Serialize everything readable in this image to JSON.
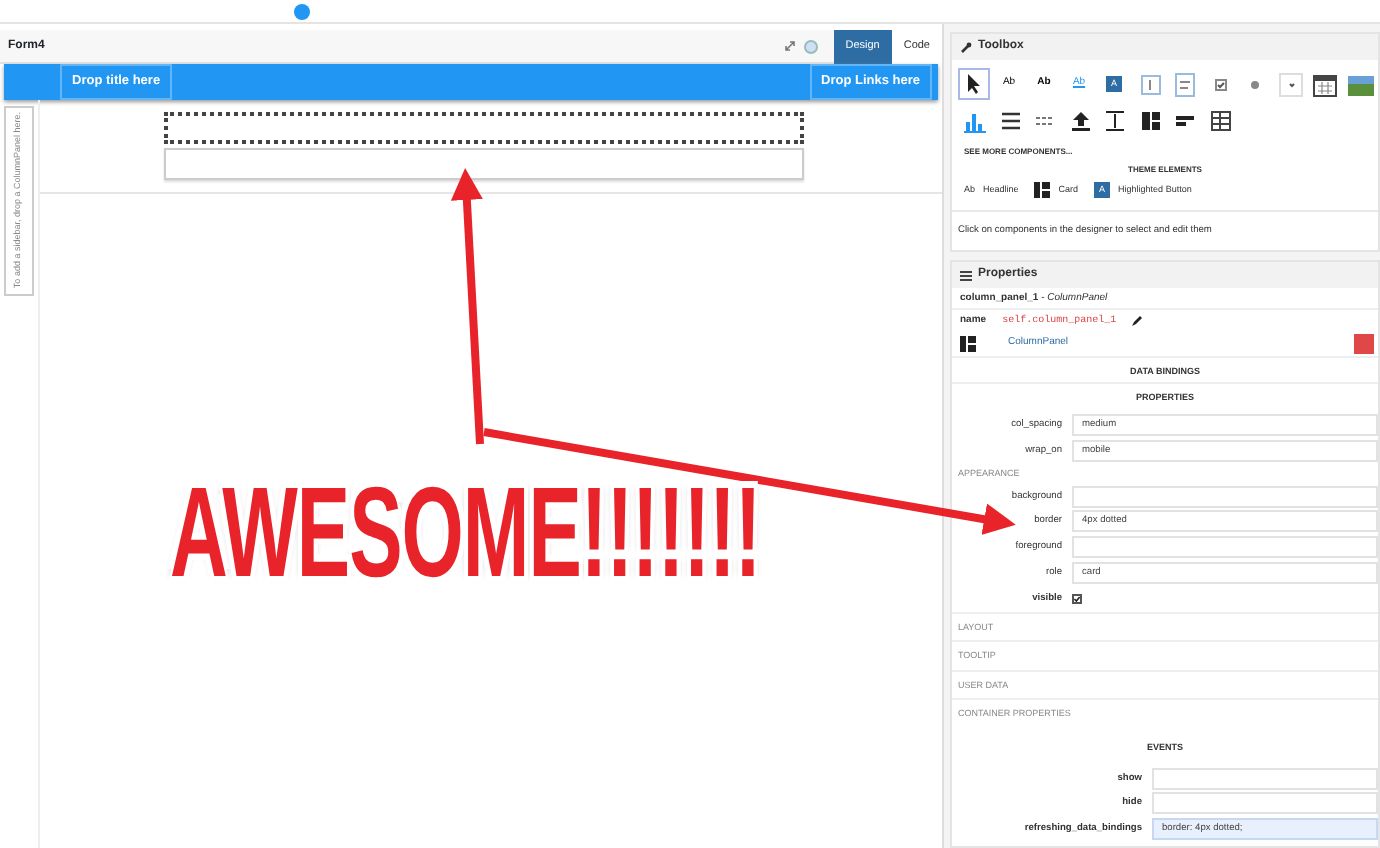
{
  "designer": {
    "title": "Form4",
    "tabs": [
      {
        "label": "Design",
        "selected": true
      },
      {
        "label": "Code",
        "selected": false
      }
    ],
    "navbar": {
      "title_slot": "Drop title here",
      "links_slot": "Drop Links here"
    },
    "sidebar_hint": "To add a sidebar, drop a ColumnPanel here."
  },
  "annotation": {
    "text": "AWESOME!!!!!!!"
  },
  "toolbox": {
    "title": "Toolbox",
    "components": [
      {
        "kind": "pointer",
        "selected": true
      },
      {
        "kind": "label",
        "label": "Ab",
        "selected": false
      },
      {
        "kind": "bold-label",
        "label": "Ab",
        "selected": false
      },
      {
        "kind": "link",
        "label": "Ab",
        "selected": false
      },
      {
        "kind": "button",
        "label": "A",
        "selected": false
      },
      {
        "kind": "textbox",
        "selected": false
      },
      {
        "kind": "textarea",
        "selected": false
      },
      {
        "kind": "checkbox",
        "selected": false
      },
      {
        "kind": "radio",
        "selected": false
      },
      {
        "kind": "dropdown",
        "selected": false
      },
      {
        "kind": "calendar",
        "selected": false
      },
      {
        "kind": "image",
        "selected": false
      },
      {
        "kind": "plot",
        "selected": false
      },
      {
        "kind": "lines",
        "selected": false
      },
      {
        "kind": "dashes",
        "selected": false
      },
      {
        "kind": "upload",
        "selected": false
      },
      {
        "kind": "spacer",
        "selected": false
      },
      {
        "kind": "columns",
        "selected": false
      },
      {
        "kind": "flow",
        "selected": false
      },
      {
        "kind": "grid",
        "selected": false
      }
    ],
    "see_more": "SEE MORE COMPONENTS...",
    "theme_heading": "THEME ELEMENTS",
    "theme_elements": [
      {
        "kind": "heading",
        "icon_label": "Ab",
        "label": "Headline"
      },
      {
        "kind": "card",
        "label": "Card"
      },
      {
        "kind": "button",
        "icon_label": "A",
        "label": "Highlighted Button"
      }
    ],
    "hint": "Click on components in the designer to select and edit them"
  },
  "properties": {
    "title": "Properties",
    "component": "**column_panel_1** - *ColumnPanel*",
    "name_label": "name",
    "name_value": "self.column_panel_1",
    "type_link": "ColumnPanel",
    "data_bindings": "DATA BINDINGS",
    "properties_heading": "PROPERTIES",
    "rows": [
      {
        "kind": "field",
        "label": "col_spacing",
        "value": "medium"
      },
      {
        "kind": "field",
        "label": "wrap_on",
        "value": "mobile"
      },
      {
        "kind": "section",
        "label": "APPEARANCE"
      },
      {
        "kind": "field",
        "label": "background"
      },
      {
        "kind": "field",
        "label": "border",
        "value": "4px dotted"
      },
      {
        "kind": "field",
        "label": "foreground"
      },
      {
        "kind": "field",
        "label": "role",
        "value": "card"
      },
      {
        "kind": "checkbox",
        "label": "visible",
        "checked": true
      },
      {
        "kind": "group",
        "label": "LAYOUT"
      },
      {
        "kind": "group",
        "label": "TOOLTIP"
      },
      {
        "kind": "group",
        "label": "USER DATA"
      },
      {
        "kind": "group",
        "label": "CONTAINER PROPERTIES"
      }
    ],
    "events_heading": "EVENTS",
    "events": [
      {
        "label": "show",
        "focused": false
      },
      {
        "label": "hide",
        "focused": false
      },
      {
        "label": "refreshing_data_bindings",
        "value": "border: 4px dotted;",
        "focused": true
      }
    ]
  }
}
